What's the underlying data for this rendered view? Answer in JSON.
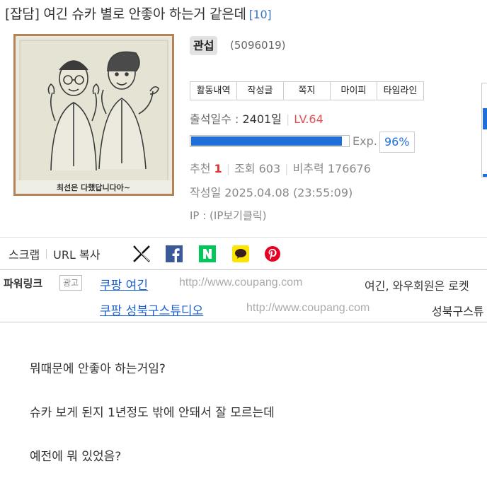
{
  "post": {
    "title": "[잡담] 여긴 슈카 별로 안좋아 하는거 같은데",
    "comment_count": "[10]"
  },
  "profile": {
    "image_caption": "최선은 다했답니다아~",
    "nickname": "관섭",
    "user_id": "(5096019)",
    "tabs": [
      "활동내역",
      "작성글",
      "쪽지",
      "마이피",
      "타임라인"
    ],
    "attendance_label": "출석일수 :",
    "attendance_value": "2401일",
    "level": "LV.64",
    "exp_label": "Exp.",
    "exp_percent": "96%",
    "exp_fraction": 0.96
  },
  "stats": {
    "recommend_label": "추천",
    "recommend_value": "1",
    "views_label": "조회",
    "views_value": "603",
    "power_label": "비추력",
    "power_value": "176676"
  },
  "meta": {
    "date": "작성일 2025.04.08 (23:55:09)",
    "ip": "IP : (IP보기클릭)"
  },
  "share": {
    "scrap": "스크랩",
    "url_copy": "URL 복사",
    "icons": [
      "x-icon",
      "facebook-icon",
      "naver-icon",
      "kakaotalk-icon",
      "pinterest-icon"
    ]
  },
  "powerlink": {
    "label": "파워링크",
    "badge": "광고",
    "ads": [
      {
        "title": "쿠팡 여긴",
        "url": "http://www.coupang.com",
        "desc": "여긴, 와우회원은 로켓"
      },
      {
        "title": "쿠팡 성북구스튜디오",
        "url": "http://www.coupang.com",
        "desc": "성북구스튜"
      }
    ]
  },
  "body": {
    "paragraphs": [
      "뭐때문에 안좋아 하는거임?",
      "슈카 보게 된지 1년정도 밖에 안돼서 잘 모르는데",
      "예전에 뭐 있었음?"
    ]
  },
  "colors": {
    "accent_blue": "#1e6fd9",
    "level_red": "#e05050",
    "link_blue": "#1a5fd1"
  }
}
